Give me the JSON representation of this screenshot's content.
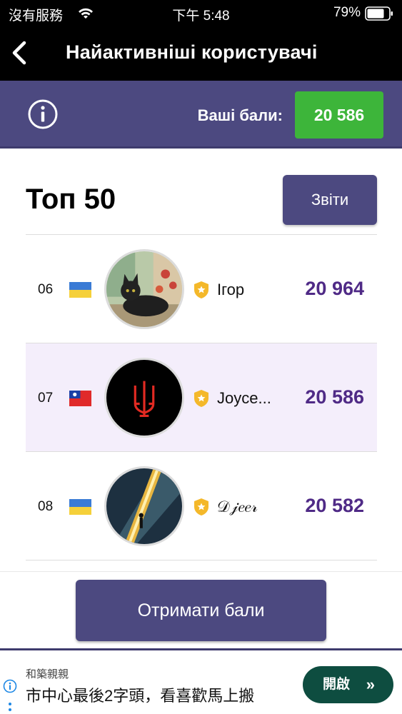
{
  "status_bar": {
    "carrier": "沒有服務",
    "time": "下午 5:48",
    "battery": "79%"
  },
  "header": {
    "title": "Найактивніші користувачі"
  },
  "points": {
    "label": "Ваші бали:",
    "value": "20 586"
  },
  "top": {
    "title": "Топ 50",
    "reports_label": "Звіти"
  },
  "rows": [
    {
      "rank": "06",
      "country": "Ukraine",
      "name": "Ігор",
      "score": "20 964"
    },
    {
      "rank": "07",
      "country": "Taiwan",
      "name": "Joyce...",
      "score": "20 586"
    },
    {
      "rank": "08",
      "country": "Ukraine",
      "name": "𝒟𝒿𝑒𝑒𝓇",
      "score": "20 582"
    }
  ],
  "get_points_label": "Отримати бали",
  "ad": {
    "advertiser": "和築親親",
    "headline": "市中心最後2字頭，看喜歡馬上搬",
    "cta": "開啟",
    "cta_icon": "»"
  },
  "colors": {
    "accent": "#4c4980",
    "points_green": "#3db53a",
    "score": "#4f2a86",
    "ad_button": "#0e4d40"
  }
}
